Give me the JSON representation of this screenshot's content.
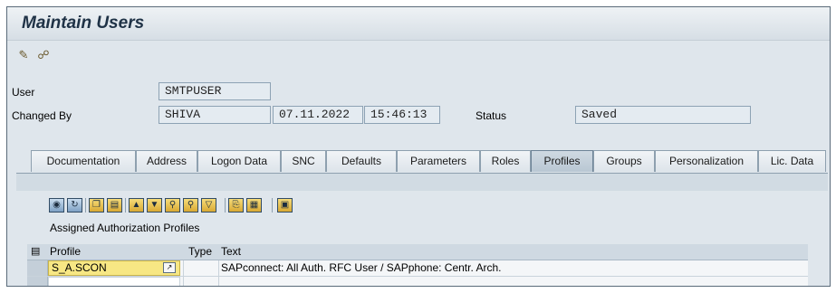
{
  "window": {
    "title": "Maintain Users"
  },
  "toolbar": {
    "icons": [
      "edit-icon",
      "lock-icon"
    ]
  },
  "header": {
    "user_label": "User",
    "user_value": "SMTPUSER",
    "changed_by_label": "Changed By",
    "changed_by_value": "SHIVA",
    "date": "07.11.2022",
    "time": "15:46:13",
    "status_label": "Status",
    "status_value": "Saved"
  },
  "tabs": [
    {
      "label": "Documentation"
    },
    {
      "label": "Address"
    },
    {
      "label": "Logon Data"
    },
    {
      "label": "SNC"
    },
    {
      "label": "Defaults"
    },
    {
      "label": "Parameters"
    },
    {
      "label": "Roles"
    },
    {
      "label": "Profiles",
      "active": true
    },
    {
      "label": "Groups"
    },
    {
      "label": "Personalization"
    },
    {
      "label": "Lic. Data"
    }
  ],
  "profiles": {
    "section_title": "Assigned Authorization Profiles",
    "columns": [
      "Profile",
      "Type",
      "Text"
    ],
    "rows": [
      {
        "profile": "S_A.SCON",
        "type": "",
        "text": "SAPconnect: All Auth. RFC User / SAPphone: Centr. Arch."
      },
      {
        "profile": "",
        "type": "",
        "text": ""
      }
    ]
  },
  "colors": {
    "accent": "#f7e784",
    "title": "#1f3246"
  }
}
